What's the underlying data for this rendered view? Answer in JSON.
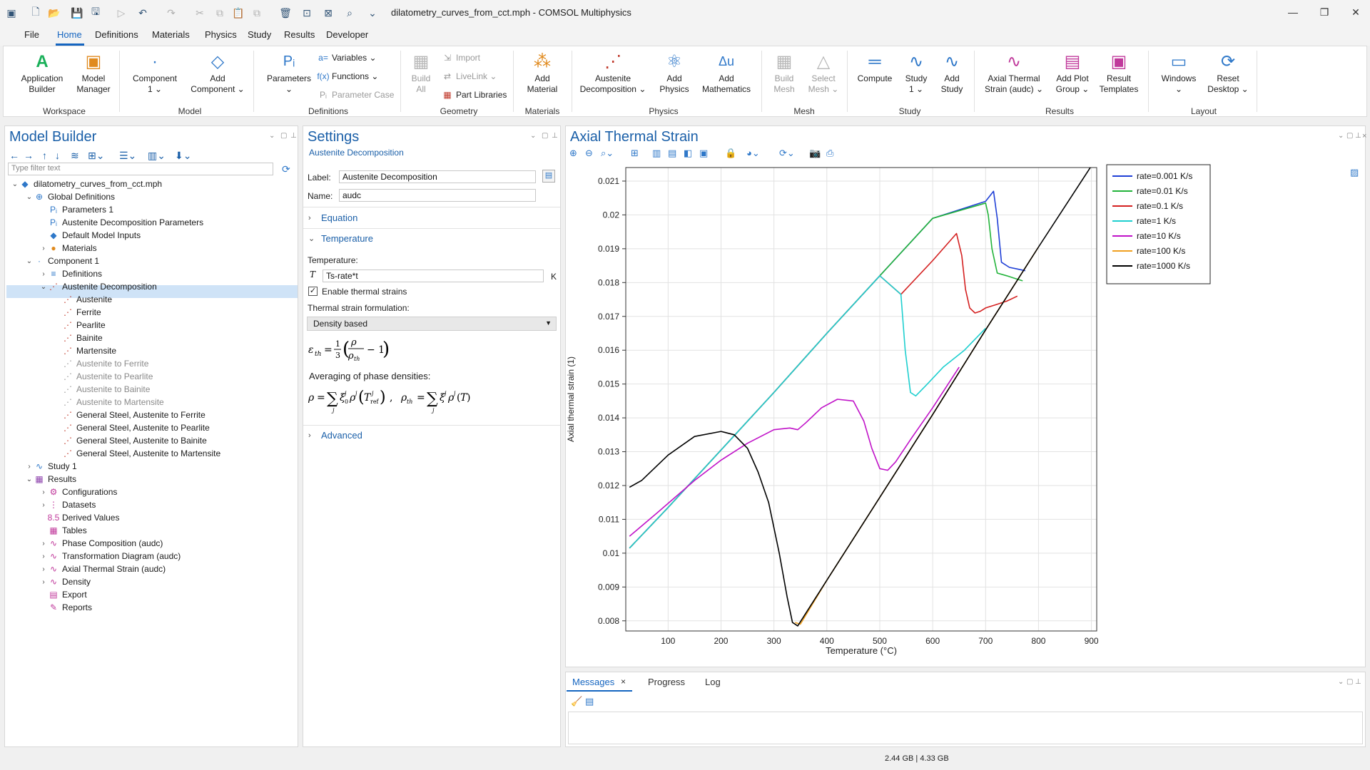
{
  "title_bar": {
    "window_title": "dilatometry_curves_from_cct.mph - COMSOL Multiphysics"
  },
  "menu": {
    "tabs": [
      "File",
      "Home",
      "Definitions",
      "Materials",
      "Physics",
      "Study",
      "Results",
      "Developer"
    ],
    "active": "Home",
    "help": "?"
  },
  "ribbon": {
    "workspace": {
      "group": "Workspace",
      "app_builder": [
        "Application",
        "Builder"
      ],
      "model_manager": [
        "Model",
        "Manager"
      ]
    },
    "model": {
      "group": "Model",
      "component": [
        "Component",
        "1 ⌄"
      ],
      "add_component": [
        "Add",
        "Component ⌄"
      ]
    },
    "definitions": {
      "group": "Definitions",
      "parameters": [
        "Parameters",
        "⌄"
      ],
      "variables": "Variables ⌄",
      "functions": "Functions ⌄",
      "parameter_case": "Parameter Case"
    },
    "geometry": {
      "group": "Geometry",
      "build_all": [
        "Build",
        "All"
      ],
      "import": "Import",
      "livelink": "LiveLink ⌄",
      "part_libraries": "Part Libraries"
    },
    "materials": {
      "group": "Materials",
      "add_material": [
        "Add",
        "Material"
      ]
    },
    "physics": {
      "group": "Physics",
      "austenite": [
        "Austenite",
        "Decomposition ⌄"
      ],
      "add_physics": [
        "Add",
        "Physics"
      ],
      "add_math": [
        "Add",
        "Mathematics"
      ]
    },
    "mesh": {
      "group": "Mesh",
      "build_mesh": [
        "Build",
        "Mesh"
      ],
      "select_mesh": [
        "Select",
        "Mesh ⌄"
      ]
    },
    "study": {
      "group": "Study",
      "compute": [
        "Compute",
        ""
      ],
      "study1": [
        "Study",
        "1 ⌄"
      ],
      "add_study": [
        "Add",
        "Study"
      ]
    },
    "results": {
      "group": "Results",
      "axial": [
        "Axial Thermal",
        "Strain (audc) ⌄"
      ],
      "add_plot": [
        "Add Plot",
        "Group ⌄"
      ],
      "templates": [
        "Result",
        "Templates"
      ]
    },
    "layout": {
      "group": "Layout",
      "windows": [
        "Windows",
        "⌄"
      ],
      "reset": [
        "Reset",
        "Desktop ⌄"
      ]
    }
  },
  "model_builder": {
    "title": "Model Builder",
    "filter_placeholder": "Type filter text",
    "tree": [
      {
        "label": "dilatometry_curves_from_cct.mph",
        "indent": 0,
        "tw": "⌄",
        "icon": "◆",
        "color": "#2f78c9",
        "name": "tree-root"
      },
      {
        "label": "Global Definitions",
        "indent": 1,
        "tw": "⌄",
        "icon": "⊕",
        "color": "#2f78c9",
        "name": "tree-global-definitions"
      },
      {
        "label": "Parameters 1",
        "indent": 2,
        "tw": "",
        "icon": "Pᵢ",
        "color": "#2f78c9",
        "name": "tree-parameters-1"
      },
      {
        "label": "Austenite Decomposition Parameters",
        "indent": 2,
        "tw": "",
        "icon": "Pᵢ",
        "color": "#2f78c9",
        "name": "tree-austenite-parameters"
      },
      {
        "label": "Default Model Inputs",
        "indent": 2,
        "tw": "",
        "icon": "◆",
        "color": "#2f78c9",
        "name": "tree-default-inputs"
      },
      {
        "label": "Materials",
        "indent": 2,
        "tw": "›",
        "icon": "●",
        "color": "#e08a1e",
        "name": "tree-materials"
      },
      {
        "label": "Component 1",
        "indent": 1,
        "tw": "⌄",
        "icon": "·",
        "color": "#2f78c9",
        "name": "tree-component-1"
      },
      {
        "label": "Definitions",
        "indent": 2,
        "tw": "›",
        "icon": "≡",
        "color": "#2f78c9",
        "name": "tree-definitions"
      },
      {
        "label": "Austenite Decomposition",
        "indent": 2,
        "tw": "⌄",
        "icon": "⋰",
        "color": "#c0392b",
        "name": "tree-austenite-decomposition"
      },
      {
        "label": "Austenite",
        "indent": 3,
        "tw": "",
        "icon": "⋰",
        "color": "#c0392b",
        "name": "tree-austenite"
      },
      {
        "label": "Ferrite",
        "indent": 3,
        "tw": "",
        "icon": "⋰",
        "color": "#c0392b",
        "name": "tree-ferrite"
      },
      {
        "label": "Pearlite",
        "indent": 3,
        "tw": "",
        "icon": "⋰",
        "color": "#c0392b",
        "name": "tree-pearlite"
      },
      {
        "label": "Bainite",
        "indent": 3,
        "tw": "",
        "icon": "⋰",
        "color": "#c0392b",
        "name": "tree-bainite"
      },
      {
        "label": "Martensite",
        "indent": 3,
        "tw": "",
        "icon": "⋰",
        "color": "#c0392b",
        "name": "tree-martensite"
      },
      {
        "label": "Austenite to Ferrite",
        "indent": 3,
        "tw": "",
        "icon": "⋰",
        "color": "#999999",
        "dis": true,
        "name": "tree-austenite-to-ferrite"
      },
      {
        "label": "Austenite to Pearlite",
        "indent": 3,
        "tw": "",
        "icon": "⋰",
        "color": "#999999",
        "dis": true,
        "name": "tree-austenite-to-pearlite"
      },
      {
        "label": "Austenite to Bainite",
        "indent": 3,
        "tw": "",
        "icon": "⋰",
        "color": "#999999",
        "dis": true,
        "name": "tree-austenite-to-bainite"
      },
      {
        "label": "Austenite to Martensite",
        "indent": 3,
        "tw": "",
        "icon": "⋰",
        "color": "#999999",
        "dis": true,
        "name": "tree-austenite-to-martensite"
      },
      {
        "label": "General Steel, Austenite to Ferrite",
        "indent": 3,
        "tw": "",
        "icon": "⋰",
        "color": "#c0392b",
        "name": "tree-gs-ferrite"
      },
      {
        "label": "General Steel, Austenite to Pearlite",
        "indent": 3,
        "tw": "",
        "icon": "⋰",
        "color": "#c0392b",
        "name": "tree-gs-pearlite"
      },
      {
        "label": "General Steel, Austenite to Bainite",
        "indent": 3,
        "tw": "",
        "icon": "⋰",
        "color": "#c0392b",
        "name": "tree-gs-bainite"
      },
      {
        "label": "General Steel, Austenite to Martensite",
        "indent": 3,
        "tw": "",
        "icon": "⋰",
        "color": "#c0392b",
        "name": "tree-gs-martensite"
      },
      {
        "label": "Study 1",
        "indent": 1,
        "tw": "›",
        "icon": "∿",
        "color": "#2f78c9",
        "name": "tree-study-1"
      },
      {
        "label": "Results",
        "indent": 1,
        "tw": "⌄",
        "icon": "▦",
        "color": "#8e44ad",
        "name": "tree-results"
      },
      {
        "label": "Configurations",
        "indent": 2,
        "tw": "›",
        "icon": "⚙",
        "color": "#c0399b",
        "name": "tree-configurations"
      },
      {
        "label": "Datasets",
        "indent": 2,
        "tw": "›",
        "icon": "⋮",
        "color": "#c0399b",
        "name": "tree-datasets"
      },
      {
        "label": "Derived Values",
        "indent": 2,
        "tw": "",
        "icon": "8.5",
        "color": "#c0399b",
        "name": "tree-derived-values"
      },
      {
        "label": "Tables",
        "indent": 2,
        "tw": "",
        "icon": "▦",
        "color": "#c0399b",
        "name": "tree-tables"
      },
      {
        "label": "Phase Composition (audc)",
        "indent": 2,
        "tw": "›",
        "icon": "∿",
        "color": "#c0399b",
        "name": "tree-phase-composition"
      },
      {
        "label": "Transformation Diagram (audc)",
        "indent": 2,
        "tw": "›",
        "icon": "∿",
        "color": "#c0399b",
        "name": "tree-transformation-diagram"
      },
      {
        "label": "Axial Thermal Strain (audc)",
        "indent": 2,
        "tw": "›",
        "icon": "∿",
        "color": "#c0399b",
        "name": "tree-axial-strain"
      },
      {
        "label": "Density",
        "indent": 2,
        "tw": "›",
        "icon": "∿",
        "color": "#c0399b",
        "name": "tree-density"
      },
      {
        "label": "Export",
        "indent": 2,
        "tw": "",
        "icon": "▤",
        "color": "#c0399b",
        "name": "tree-export"
      },
      {
        "label": "Reports",
        "indent": 2,
        "tw": "",
        "icon": "✎",
        "color": "#c0399b",
        "name": "tree-reports"
      }
    ]
  },
  "settings": {
    "title": "Settings",
    "subtitle": "Austenite Decomposition",
    "label_caption": "Label:",
    "label_value": "Austenite Decomposition",
    "name_caption": "Name:",
    "name_value": "audc",
    "equation": "Equation",
    "temperature_section": "Temperature",
    "temperature_caption": "Temperature:",
    "t_symbol": "T",
    "temperature_value": "Ts-rate*t",
    "temperature_unit": "K",
    "enable_thermal": "Enable thermal strains",
    "formulation_caption": "Thermal strain formulation:",
    "formulation_value": "Density based",
    "averaging_caption": "Averaging of phase densities:",
    "advanced": "Advanced"
  },
  "graphics": {
    "title": "Axial Thermal Strain"
  },
  "chart_data": {
    "type": "line",
    "title": "",
    "xlabel": "Temperature (°C)",
    "ylabel": "Axial thermal strain (1)",
    "xlim": [
      20,
      910
    ],
    "ylim": [
      0.0077,
      0.0214
    ],
    "xticks": [
      100,
      200,
      300,
      400,
      500,
      600,
      700,
      800,
      900
    ],
    "yticks": [
      0.008,
      0.009,
      0.01,
      0.011,
      0.012,
      0.013,
      0.014,
      0.015,
      0.016,
      0.017,
      0.018,
      0.019,
      0.02,
      0.021
    ],
    "grid": true,
    "legend_position": "top-right",
    "series": [
      {
        "name": "rate=0.001 K/s",
        "color": "#1f3fd6",
        "x": [
          27,
          100,
          200,
          300,
          400,
          500,
          600,
          700,
          715,
          722,
          730,
          745,
          760,
          775
        ],
        "y": [
          0.01015,
          0.01135,
          0.01305,
          0.01475,
          0.0165,
          0.0182,
          0.0199,
          0.0204,
          0.0207,
          0.0199,
          0.0186,
          0.01845,
          0.0184,
          0.01835
        ]
      },
      {
        "name": "rate=0.01 K/s",
        "color": "#22b33a",
        "x": [
          27,
          100,
          200,
          300,
          400,
          500,
          600,
          700,
          705,
          712,
          722,
          740,
          760,
          770
        ],
        "y": [
          0.01015,
          0.01135,
          0.01305,
          0.01475,
          0.0165,
          0.0182,
          0.0199,
          0.02035,
          0.02,
          0.019,
          0.01828,
          0.0182,
          0.0181,
          0.01805
        ]
      },
      {
        "name": "rate=0.1 K/s",
        "color": "#d42020",
        "x": [
          27,
          100,
          200,
          300,
          400,
          500,
          540,
          600,
          645,
          655,
          662,
          670,
          680,
          690,
          700,
          720,
          740,
          760
        ],
        "y": [
          0.01015,
          0.01135,
          0.01305,
          0.01475,
          0.0165,
          0.0182,
          0.01765,
          0.01865,
          0.01945,
          0.0188,
          0.0178,
          0.01725,
          0.0171,
          0.01715,
          0.01725,
          0.01735,
          0.01745,
          0.0176
        ]
      },
      {
        "name": "rate=1 K/s",
        "color": "#1ecfcf",
        "x": [
          27,
          100,
          200,
          300,
          400,
          500,
          540,
          548,
          558,
          568,
          590,
          620,
          660,
          700
        ],
        "y": [
          0.01015,
          0.01135,
          0.01305,
          0.01475,
          0.0165,
          0.0182,
          0.01765,
          0.016,
          0.01475,
          0.01465,
          0.015,
          0.0155,
          0.016,
          0.01665
        ]
      },
      {
        "name": "rate=10 K/s",
        "color": "#c012c8",
        "x": [
          27,
          80,
          150,
          200,
          250,
          300,
          330,
          345,
          360,
          390,
          420,
          450,
          470,
          485,
          500,
          515,
          530,
          560,
          600,
          650
        ],
        "y": [
          0.0105,
          0.0112,
          0.01215,
          0.01275,
          0.01325,
          0.01365,
          0.0137,
          0.01365,
          0.01385,
          0.0143,
          0.01455,
          0.0145,
          0.0139,
          0.0131,
          0.0125,
          0.01245,
          0.0127,
          0.0134,
          0.0143,
          0.0155
        ]
      },
      {
        "name": "rate=100 K/s",
        "color": "#f0a020",
        "x": [
          340,
          350,
          400,
          500,
          600,
          700,
          800
        ],
        "y": [
          0.00795,
          0.0079,
          0.0092,
          0.01165,
          0.0141,
          0.0166,
          0.01905
        ]
      },
      {
        "name": "rate=1000 K/s",
        "color": "#000000",
        "x": [
          27,
          50,
          100,
          150,
          200,
          225,
          250,
          270,
          290,
          310,
          325,
          335,
          345,
          400,
          500,
          600,
          700,
          800,
          900
        ],
        "y": [
          0.01195,
          0.01215,
          0.0129,
          0.01345,
          0.0136,
          0.0135,
          0.0131,
          0.0124,
          0.0115,
          0.01,
          0.0087,
          0.00795,
          0.00785,
          0.0092,
          0.01165,
          0.0141,
          0.0166,
          0.01905,
          0.02145
        ]
      }
    ]
  },
  "messages": {
    "tabs": [
      "Messages",
      "Progress",
      "Log"
    ],
    "active": "Messages",
    "close": "×"
  },
  "status": {
    "memory": "2.44 GB | 4.33 GB"
  }
}
